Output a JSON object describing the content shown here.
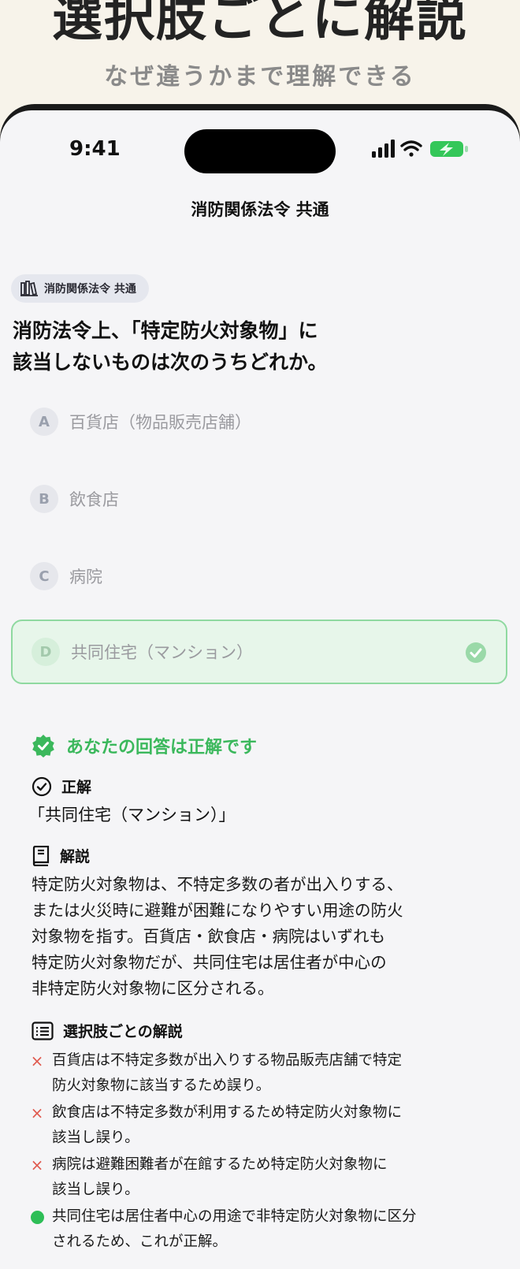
{
  "promo": {
    "title": "選択肢ごとに解説",
    "subtitle": "なぜ違うかまで理解できる"
  },
  "status_bar": {
    "time": "9:41",
    "icons": [
      "signal-icon",
      "wifi-icon",
      "battery-charging-icon"
    ],
    "battery_color": "#34c759"
  },
  "nav": {
    "title": "消防関係法令 共通"
  },
  "category": {
    "icon": "books-icon",
    "label": "消防関係法令 共通"
  },
  "question": {
    "line1": "消防法令上、「特定防火対象物」に",
    "line2": "該当しないものは次のうちどれか。"
  },
  "options": [
    {
      "letter": "A",
      "text": "百貨店（物品販売店舗）",
      "selected": false
    },
    {
      "letter": "B",
      "text": "飲食店",
      "selected": false
    },
    {
      "letter": "C",
      "text": "病院",
      "selected": false
    },
    {
      "letter": "D",
      "text": "共同住宅（マンション）",
      "selected": true
    }
  ],
  "result": {
    "icon": "verified-badge-icon",
    "text": "あなたの回答は正解です",
    "color": "#3bb85c"
  },
  "answer": {
    "icon": "check-circle-icon",
    "heading": "正解",
    "text": "「共同住宅（マンション）」"
  },
  "explanation": {
    "icon": "book-icon",
    "heading": "解説",
    "lines": [
      "特定防火対象物は、不特定多数の者が出入りする、",
      "または火災時に避難が困難になりやすい用途の防火",
      "対象物を指す。百貨店・飲食店・病院はいずれも",
      "特定防火対象物だが、共同住宅は居住者が中心の",
      "非特定防火対象物に区分される。"
    ]
  },
  "choice_explanations": {
    "icon": "list-icon",
    "heading": "選択肢ごとの解説",
    "items": [
      {
        "mark": "×",
        "line1": "百貨店は不特定多数が出入りする物品販売店舗で特定",
        "line2": "防火対象物に該当するため誤り。"
      },
      {
        "mark": "×",
        "line1": "飲食店は不特定多数が利用するため特定防火対象物に",
        "line2": "該当し誤り。"
      },
      {
        "mark": "×",
        "line1": "病院は避難困難者が在館するため特定防火対象物に",
        "line2": "該当し誤り。"
      },
      {
        "mark": "",
        "line1": "共同住宅は居住者中心の用途で非特定防火対象物に区分",
        "line2": "されるため、これが正解。"
      }
    ]
  }
}
